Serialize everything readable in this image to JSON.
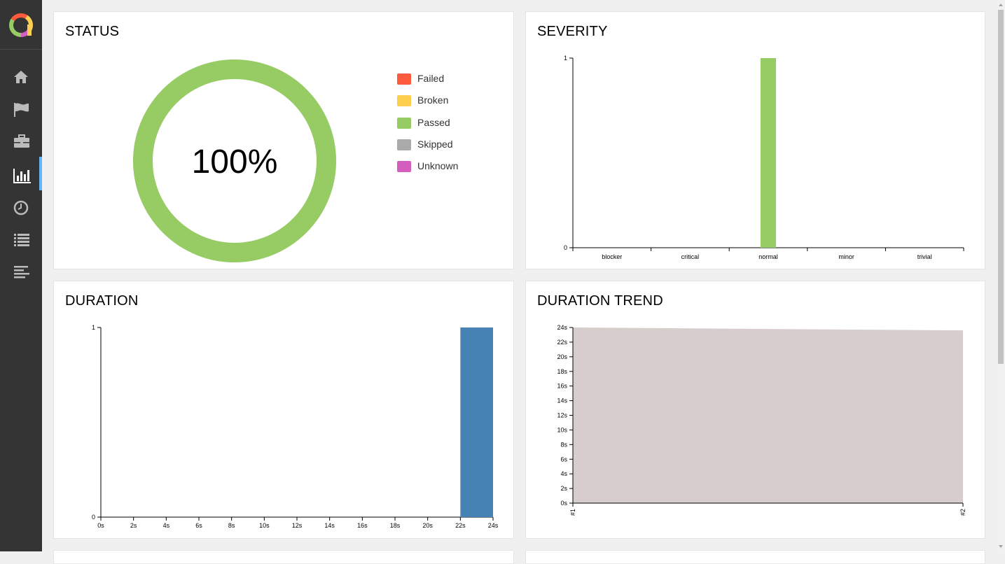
{
  "sidebar": {
    "logo_icon": "allure-logo",
    "items": [
      {
        "icon": "home-icon",
        "name": "sidebar-item-overview",
        "active": false
      },
      {
        "icon": "flag-icon",
        "name": "sidebar-item-categories",
        "active": false
      },
      {
        "icon": "briefcase-icon",
        "name": "sidebar-item-suites",
        "active": false
      },
      {
        "icon": "bar-chart-icon",
        "name": "sidebar-item-graphs",
        "active": true
      },
      {
        "icon": "clock-icon",
        "name": "sidebar-item-timeline",
        "active": false
      },
      {
        "icon": "list-icon",
        "name": "sidebar-item-behaviors",
        "active": false
      },
      {
        "icon": "align-left-icon",
        "name": "sidebar-item-packages",
        "active": false
      }
    ]
  },
  "status": {
    "title": "STATUS",
    "percent_label": "100%",
    "passed_fraction": 1.0,
    "legend": [
      {
        "label": "Failed",
        "color": "#fd5a3e"
      },
      {
        "label": "Broken",
        "color": "#ffd050"
      },
      {
        "label": "Passed",
        "color": "#97cc64"
      },
      {
        "label": "Skipped",
        "color": "#aaaaaa"
      },
      {
        "label": "Unknown",
        "color": "#d35ebe"
      }
    ]
  },
  "severity": {
    "title": "SEVERITY"
  },
  "duration": {
    "title": "DURATION"
  },
  "duration_trend": {
    "title": "DURATION TREND"
  },
  "chart_data": [
    {
      "type": "bar",
      "title": "SEVERITY",
      "categories": [
        "blocker",
        "critical",
        "normal",
        "minor",
        "trivial"
      ],
      "values": [
        0,
        0,
        1,
        0,
        0
      ],
      "color": "#97cc64",
      "ylim": [
        0,
        1
      ],
      "yticks": [
        "0",
        "1"
      ],
      "grid": false
    },
    {
      "type": "bar",
      "title": "DURATION",
      "x_ticks": [
        "0s",
        "2s",
        "4s",
        "6s",
        "8s",
        "10s",
        "12s",
        "14s",
        "16s",
        "18s",
        "20s",
        "22s",
        "24s"
      ],
      "bins": [
        {
          "from": 22,
          "to": 24,
          "value": 1
        }
      ],
      "color": "#4682b4",
      "xlim": [
        0,
        24
      ],
      "ylim": [
        0,
        1
      ],
      "yticks": [
        "0",
        "1"
      ],
      "grid": false
    },
    {
      "type": "area",
      "title": "DURATION TREND",
      "x": [
        "#1",
        "#2"
      ],
      "values": [
        24,
        23.6
      ],
      "color": "#d6cdcc",
      "ylim": [
        0,
        24
      ],
      "yticks": [
        "0s",
        "2s",
        "4s",
        "6s",
        "8s",
        "10s",
        "12s",
        "14s",
        "16s",
        "18s",
        "20s",
        "22s",
        "24s"
      ],
      "grid": false
    }
  ]
}
